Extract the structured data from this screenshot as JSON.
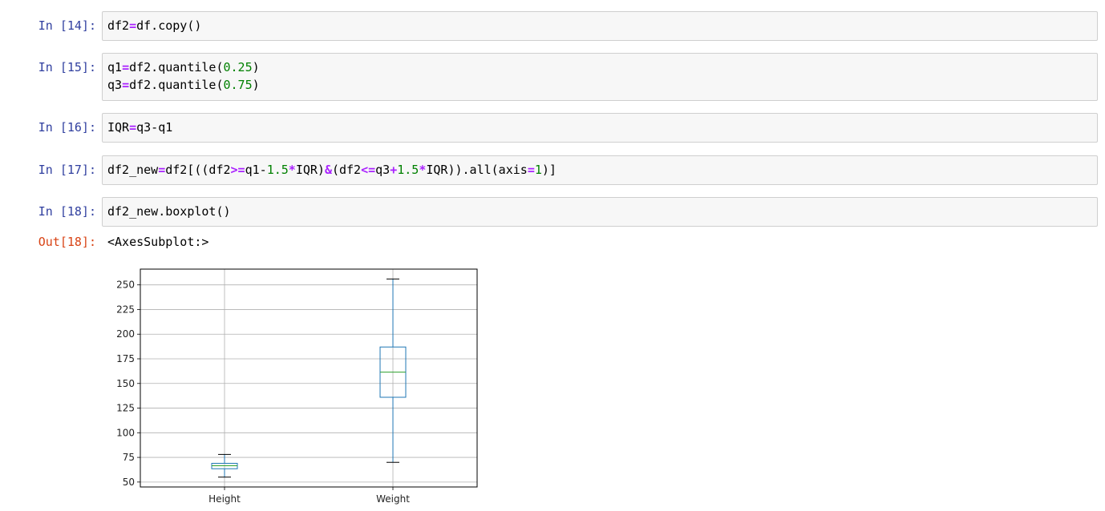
{
  "cells": [
    {
      "prompt": "In [14]:",
      "lines": [
        [
          [
            "t",
            "df2"
          ],
          [
            "op",
            "="
          ],
          [
            "t",
            "df.copy()"
          ]
        ]
      ]
    },
    {
      "prompt": "In [15]:",
      "lines": [
        [
          [
            "t",
            "q1"
          ],
          [
            "op",
            "="
          ],
          [
            "t",
            "df2.quantile("
          ],
          [
            "num",
            "0.25"
          ],
          [
            "t",
            ")"
          ]
        ],
        [
          [
            "t",
            "q3"
          ],
          [
            "op",
            "="
          ],
          [
            "t",
            "df2.quantile("
          ],
          [
            "num",
            "0.75"
          ],
          [
            "t",
            ")"
          ]
        ]
      ]
    },
    {
      "prompt": "In [16]:",
      "lines": [
        [
          [
            "t",
            "IQR"
          ],
          [
            "op",
            "="
          ],
          [
            "t",
            "q3-q1"
          ]
        ]
      ]
    },
    {
      "prompt": "In [17]:",
      "lines": [
        [
          [
            "t",
            "df2_new"
          ],
          [
            "op",
            "="
          ],
          [
            "t",
            "df2[((df2"
          ],
          [
            "op",
            ">="
          ],
          [
            "t",
            "q1-"
          ],
          [
            "num",
            "1.5"
          ],
          [
            "op",
            "*"
          ],
          [
            "t",
            "IQR)"
          ],
          [
            "op",
            "&"
          ],
          [
            "t",
            "(df2"
          ],
          [
            "op",
            "<="
          ],
          [
            "t",
            "q3"
          ],
          [
            "op",
            "+"
          ],
          [
            "num",
            "1.5"
          ],
          [
            "op",
            "*"
          ],
          [
            "t",
            "IQR)).all(axis"
          ],
          [
            "op",
            "="
          ],
          [
            "num",
            "1"
          ],
          [
            "t",
            ")]"
          ]
        ]
      ]
    },
    {
      "prompt": "In [18]:",
      "lines": [
        [
          [
            "t",
            "df2_new.boxplot()"
          ]
        ]
      ]
    }
  ],
  "output": {
    "prompt": "Out[18]:",
    "text": "<AxesSubplot:>"
  },
  "chart_data": {
    "type": "box",
    "categories": [
      "Height",
      "Weight"
    ],
    "boxes": [
      {
        "name": "Height",
        "whislo": 55,
        "q1": 63.5,
        "med": 66.5,
        "q3": 69,
        "whishi": 78
      },
      {
        "name": "Weight",
        "whislo": 70,
        "q1": 136,
        "med": 161.5,
        "q3": 187,
        "whishi": 256
      }
    ],
    "yticks": [
      50,
      75,
      100,
      125,
      150,
      175,
      200,
      225,
      250
    ],
    "ylim": [
      45,
      266
    ],
    "grid": true,
    "colors": {
      "box": "#1f77b4",
      "median": "#2ca02c",
      "cap": "#000000",
      "grid": "#b0b0b0"
    }
  }
}
